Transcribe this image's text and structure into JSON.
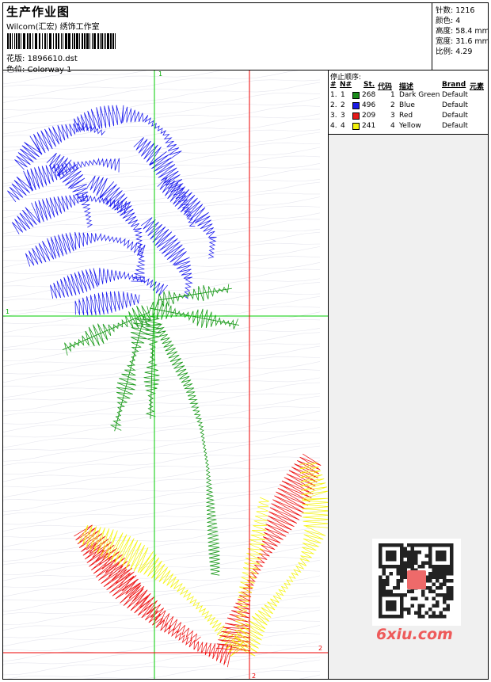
{
  "header": {
    "title": "生产作业图",
    "company": "Wilcom(汇宏) 绣饰工作室",
    "design_label": "花版:",
    "design_value": "1896610.dst",
    "colorway_label": "色位:",
    "colorway_value": "Colorway 1"
  },
  "stats": {
    "stitches_label": "针数:",
    "stitches_value": "1216",
    "colors_label": "颜色:",
    "colors_value": "4",
    "height_label": "高度:",
    "height_value": "58.4 mm",
    "width_label": "宽度:",
    "width_value": "31.6 mm",
    "ratio_label": "比例:",
    "ratio_value": "4.29"
  },
  "stop_sequence": {
    "title": "停止顺序:",
    "headers": {
      "idx": "#",
      "no": "N#",
      "st": "St.",
      "code": "代码",
      "desc": "描述",
      "brand": "Brand",
      "element": "元素"
    },
    "rows": [
      {
        "idx": "1.",
        "no": "1",
        "st": "268",
        "code": "1",
        "desc": "Dark Green",
        "brand": "Default",
        "color": "#1a8c1a"
      },
      {
        "idx": "2.",
        "no": "2",
        "st": "496",
        "code": "2",
        "desc": "Blue",
        "brand": "Default",
        "color": "#1a1ae6"
      },
      {
        "idx": "3.",
        "no": "3",
        "st": "209",
        "code": "3",
        "desc": "Red",
        "brand": "Default",
        "color": "#e61a1a"
      },
      {
        "idx": "4.",
        "no": "4",
        "st": "241",
        "code": "4",
        "desc": "Yellow",
        "brand": "Default",
        "color": "#f2f20d"
      }
    ]
  },
  "guides": {
    "v1_label": "1",
    "h1_label": "1",
    "v2_label": "2",
    "h2_label": "2"
  },
  "watermark": {
    "text": "6xiu.com"
  },
  "colors": {
    "green": "#1a9a1a",
    "blue": "#1a1aee",
    "red": "#ee1010",
    "yellow": "#f5f510",
    "guide_green": "#00cc00",
    "guide_red": "#ee0000"
  }
}
